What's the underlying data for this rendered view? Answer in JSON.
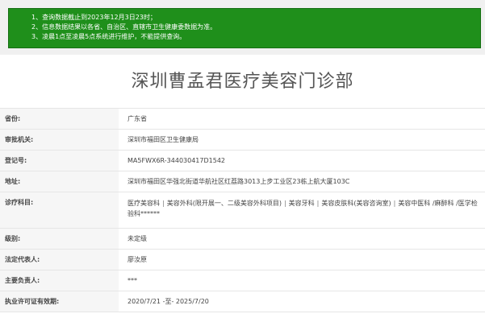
{
  "notice": {
    "lines": [
      "1、查询数据截止到2023年12月3日23时；",
      "2、信息数据结果以各省、自治区、直辖市卫生健康委数据为准。",
      "3、凌晨1点至凌晨5点系统进行维护，不能提供查询。"
    ]
  },
  "title": "深圳曹孟君医疗美容门诊部",
  "fields": [
    {
      "label": "省份:",
      "value": "广东省"
    },
    {
      "label": "审批机关:",
      "value": "深圳市福田区卫生健康局"
    },
    {
      "label": "登记号:",
      "value": "MA5FWX6R-344030417D1542"
    },
    {
      "label": "地址:",
      "value": "深圳市福田区华强北街道华航社区红荔路3013上步工业区23栋上航大厦103C"
    },
    {
      "label": "诊疗科目:",
      "departments": [
        "医疗美容科",
        "美容外科(限开展一、二级美容外科项目)",
        "美容牙科",
        "美容皮肤科(美容咨询室)",
        "美容中医科 /麻醉科 /医学检验科******"
      ]
    },
    {
      "label": "级别:",
      "value": "未定级"
    },
    {
      "label": "法定代表人:",
      "value": "廖汝原"
    },
    {
      "label": "主要负责人:",
      "value": "***"
    },
    {
      "label": "执业许可证有效期:",
      "value": "2020/7/21 -至- 2025/7/20"
    }
  ]
}
